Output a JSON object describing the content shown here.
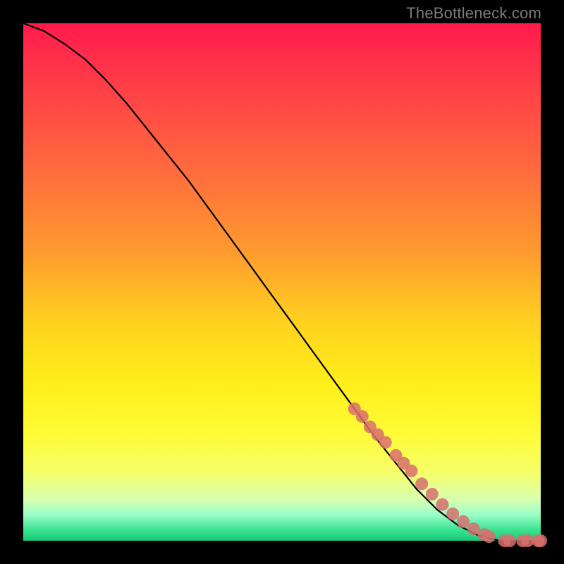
{
  "attribution": "TheBottleneck.com",
  "colors": {
    "marker": "#d86e6e",
    "curve": "#000000",
    "background_deep": "#000000"
  },
  "chart_data": {
    "type": "line",
    "title": "",
    "xlabel": "",
    "ylabel": "",
    "xlim": [
      0,
      100
    ],
    "ylim": [
      0,
      100
    ],
    "series": [
      {
        "name": "bottleneck-curve",
        "x": [
          0,
          4,
          8,
          12,
          16,
          20,
          24,
          28,
          32,
          36,
          40,
          44,
          48,
          52,
          56,
          60,
          64,
          68,
          72,
          76,
          80,
          84,
          88,
          90,
          92,
          94,
          96,
          98,
          100
        ],
        "y": [
          100,
          98.5,
          96,
          93,
          89,
          84.5,
          79.5,
          74.5,
          69.5,
          64,
          58.5,
          53,
          47.5,
          42,
          36.5,
          31,
          25.5,
          20,
          15,
          10,
          6,
          3,
          1,
          0.5,
          0,
          0,
          0,
          0,
          0
        ]
      }
    ],
    "markers": {
      "name": "highlighted-points",
      "x": [
        64,
        65.5,
        67,
        68.5,
        70,
        72,
        73.5,
        75,
        77,
        79,
        81,
        83,
        85,
        87,
        89,
        90,
        93,
        94,
        96.5,
        97.5,
        99.5,
        100
      ],
      "y": [
        25.5,
        24,
        22,
        20.5,
        19,
        16.5,
        15,
        13.5,
        11,
        9,
        7,
        5.2,
        3.7,
        2.3,
        1.2,
        0.8,
        0,
        0,
        0,
        0,
        0,
        0
      ]
    }
  }
}
